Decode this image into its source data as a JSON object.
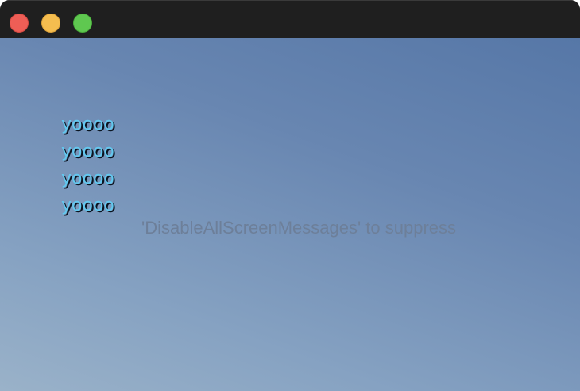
{
  "window": {
    "controls": [
      "close",
      "minimize",
      "maximize"
    ],
    "colors": {
      "close": "#ee5e56",
      "minimize": "#f5bd4f",
      "maximize": "#5fc850",
      "titlebar": "#1f1f1f"
    }
  },
  "viewport": {
    "background_top": "#5677a7",
    "background_bottom": "#9ab2c9",
    "messages": [
      "yoooo",
      "yoooo",
      "yoooo",
      "yoooo"
    ],
    "message_color": "#62c8ef",
    "suppress_hint": "'DisableAllScreenMessages' to suppress",
    "suppress_color": "#6d7f99"
  }
}
